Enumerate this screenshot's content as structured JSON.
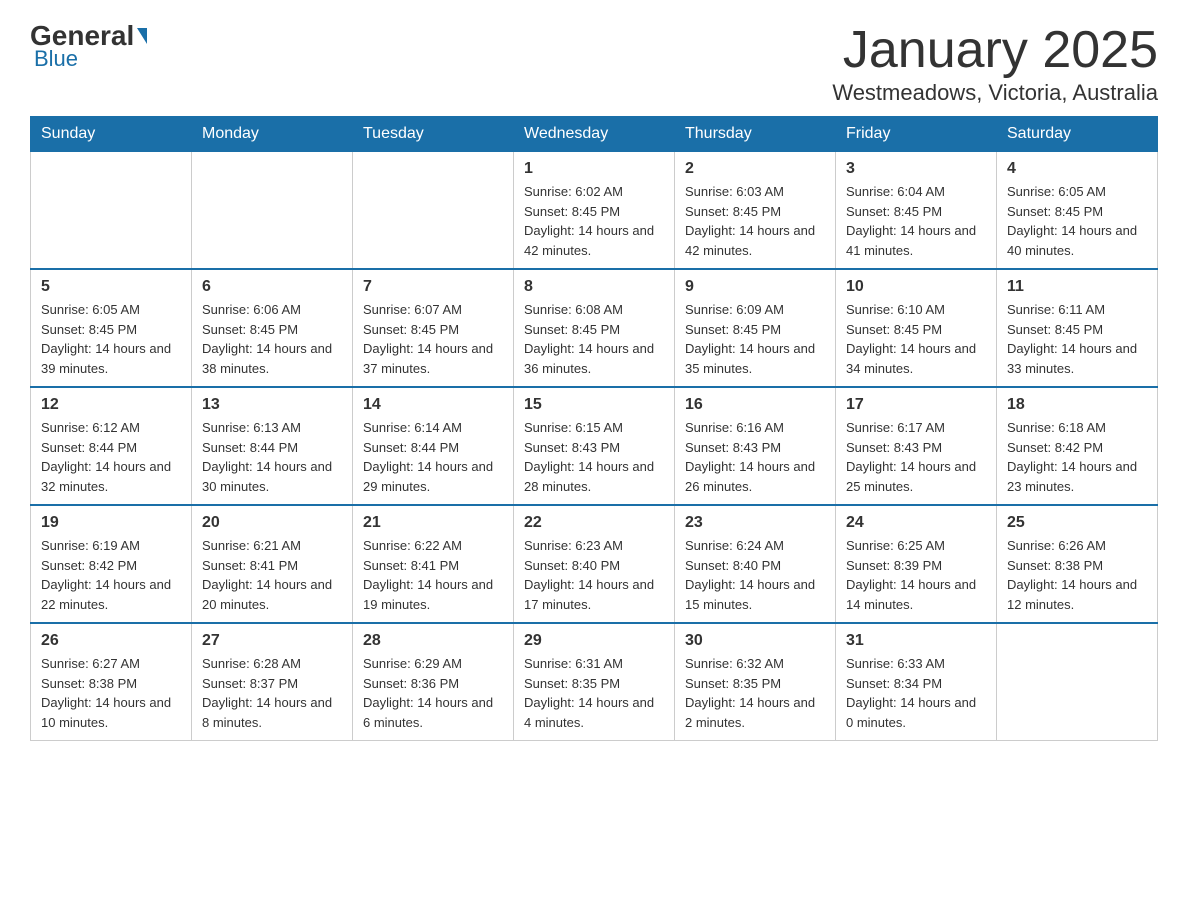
{
  "header": {
    "logo_text_general": "General",
    "logo_text_blue": "Blue",
    "month_title": "January 2025",
    "location": "Westmeadows, Victoria, Australia"
  },
  "days_of_week": [
    "Sunday",
    "Monday",
    "Tuesday",
    "Wednesday",
    "Thursday",
    "Friday",
    "Saturday"
  ],
  "weeks": [
    [
      {
        "day": "",
        "sunrise": "",
        "sunset": "",
        "daylight": ""
      },
      {
        "day": "",
        "sunrise": "",
        "sunset": "",
        "daylight": ""
      },
      {
        "day": "",
        "sunrise": "",
        "sunset": "",
        "daylight": ""
      },
      {
        "day": "1",
        "sunrise": "Sunrise: 6:02 AM",
        "sunset": "Sunset: 8:45 PM",
        "daylight": "Daylight: 14 hours and 42 minutes."
      },
      {
        "day": "2",
        "sunrise": "Sunrise: 6:03 AM",
        "sunset": "Sunset: 8:45 PM",
        "daylight": "Daylight: 14 hours and 42 minutes."
      },
      {
        "day": "3",
        "sunrise": "Sunrise: 6:04 AM",
        "sunset": "Sunset: 8:45 PM",
        "daylight": "Daylight: 14 hours and 41 minutes."
      },
      {
        "day": "4",
        "sunrise": "Sunrise: 6:05 AM",
        "sunset": "Sunset: 8:45 PM",
        "daylight": "Daylight: 14 hours and 40 minutes."
      }
    ],
    [
      {
        "day": "5",
        "sunrise": "Sunrise: 6:05 AM",
        "sunset": "Sunset: 8:45 PM",
        "daylight": "Daylight: 14 hours and 39 minutes."
      },
      {
        "day": "6",
        "sunrise": "Sunrise: 6:06 AM",
        "sunset": "Sunset: 8:45 PM",
        "daylight": "Daylight: 14 hours and 38 minutes."
      },
      {
        "day": "7",
        "sunrise": "Sunrise: 6:07 AM",
        "sunset": "Sunset: 8:45 PM",
        "daylight": "Daylight: 14 hours and 37 minutes."
      },
      {
        "day": "8",
        "sunrise": "Sunrise: 6:08 AM",
        "sunset": "Sunset: 8:45 PM",
        "daylight": "Daylight: 14 hours and 36 minutes."
      },
      {
        "day": "9",
        "sunrise": "Sunrise: 6:09 AM",
        "sunset": "Sunset: 8:45 PM",
        "daylight": "Daylight: 14 hours and 35 minutes."
      },
      {
        "day": "10",
        "sunrise": "Sunrise: 6:10 AM",
        "sunset": "Sunset: 8:45 PM",
        "daylight": "Daylight: 14 hours and 34 minutes."
      },
      {
        "day": "11",
        "sunrise": "Sunrise: 6:11 AM",
        "sunset": "Sunset: 8:45 PM",
        "daylight": "Daylight: 14 hours and 33 minutes."
      }
    ],
    [
      {
        "day": "12",
        "sunrise": "Sunrise: 6:12 AM",
        "sunset": "Sunset: 8:44 PM",
        "daylight": "Daylight: 14 hours and 32 minutes."
      },
      {
        "day": "13",
        "sunrise": "Sunrise: 6:13 AM",
        "sunset": "Sunset: 8:44 PM",
        "daylight": "Daylight: 14 hours and 30 minutes."
      },
      {
        "day": "14",
        "sunrise": "Sunrise: 6:14 AM",
        "sunset": "Sunset: 8:44 PM",
        "daylight": "Daylight: 14 hours and 29 minutes."
      },
      {
        "day": "15",
        "sunrise": "Sunrise: 6:15 AM",
        "sunset": "Sunset: 8:43 PM",
        "daylight": "Daylight: 14 hours and 28 minutes."
      },
      {
        "day": "16",
        "sunrise": "Sunrise: 6:16 AM",
        "sunset": "Sunset: 8:43 PM",
        "daylight": "Daylight: 14 hours and 26 minutes."
      },
      {
        "day": "17",
        "sunrise": "Sunrise: 6:17 AM",
        "sunset": "Sunset: 8:43 PM",
        "daylight": "Daylight: 14 hours and 25 minutes."
      },
      {
        "day": "18",
        "sunrise": "Sunrise: 6:18 AM",
        "sunset": "Sunset: 8:42 PM",
        "daylight": "Daylight: 14 hours and 23 minutes."
      }
    ],
    [
      {
        "day": "19",
        "sunrise": "Sunrise: 6:19 AM",
        "sunset": "Sunset: 8:42 PM",
        "daylight": "Daylight: 14 hours and 22 minutes."
      },
      {
        "day": "20",
        "sunrise": "Sunrise: 6:21 AM",
        "sunset": "Sunset: 8:41 PM",
        "daylight": "Daylight: 14 hours and 20 minutes."
      },
      {
        "day": "21",
        "sunrise": "Sunrise: 6:22 AM",
        "sunset": "Sunset: 8:41 PM",
        "daylight": "Daylight: 14 hours and 19 minutes."
      },
      {
        "day": "22",
        "sunrise": "Sunrise: 6:23 AM",
        "sunset": "Sunset: 8:40 PM",
        "daylight": "Daylight: 14 hours and 17 minutes."
      },
      {
        "day": "23",
        "sunrise": "Sunrise: 6:24 AM",
        "sunset": "Sunset: 8:40 PM",
        "daylight": "Daylight: 14 hours and 15 minutes."
      },
      {
        "day": "24",
        "sunrise": "Sunrise: 6:25 AM",
        "sunset": "Sunset: 8:39 PM",
        "daylight": "Daylight: 14 hours and 14 minutes."
      },
      {
        "day": "25",
        "sunrise": "Sunrise: 6:26 AM",
        "sunset": "Sunset: 8:38 PM",
        "daylight": "Daylight: 14 hours and 12 minutes."
      }
    ],
    [
      {
        "day": "26",
        "sunrise": "Sunrise: 6:27 AM",
        "sunset": "Sunset: 8:38 PM",
        "daylight": "Daylight: 14 hours and 10 minutes."
      },
      {
        "day": "27",
        "sunrise": "Sunrise: 6:28 AM",
        "sunset": "Sunset: 8:37 PM",
        "daylight": "Daylight: 14 hours and 8 minutes."
      },
      {
        "day": "28",
        "sunrise": "Sunrise: 6:29 AM",
        "sunset": "Sunset: 8:36 PM",
        "daylight": "Daylight: 14 hours and 6 minutes."
      },
      {
        "day": "29",
        "sunrise": "Sunrise: 6:31 AM",
        "sunset": "Sunset: 8:35 PM",
        "daylight": "Daylight: 14 hours and 4 minutes."
      },
      {
        "day": "30",
        "sunrise": "Sunrise: 6:32 AM",
        "sunset": "Sunset: 8:35 PM",
        "daylight": "Daylight: 14 hours and 2 minutes."
      },
      {
        "day": "31",
        "sunrise": "Sunrise: 6:33 AM",
        "sunset": "Sunset: 8:34 PM",
        "daylight": "Daylight: 14 hours and 0 minutes."
      },
      {
        "day": "",
        "sunrise": "",
        "sunset": "",
        "daylight": ""
      }
    ]
  ]
}
